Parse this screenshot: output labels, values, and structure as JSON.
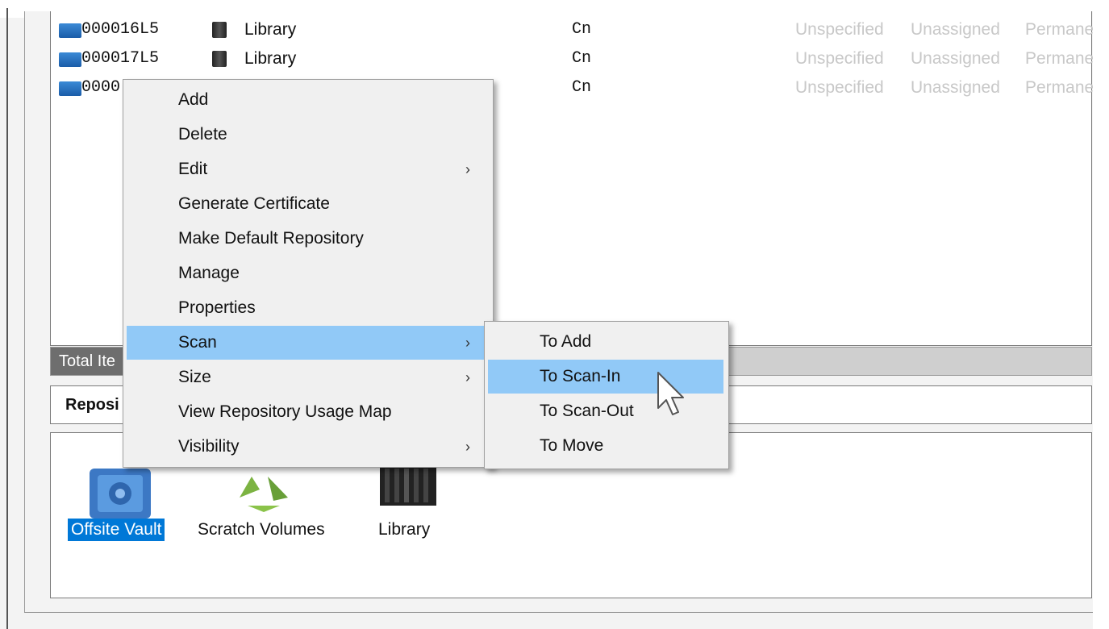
{
  "volumes": [
    {
      "id": "000016L5",
      "repository": "Library",
      "cn": "Cn",
      "col1": "Unspecified",
      "col2": "Unassigned",
      "col3": "Permane"
    },
    {
      "id": "000017L5",
      "repository": "Library",
      "cn": "Cn",
      "col1": "Unspecified",
      "col2": "Unassigned",
      "col3": "Permane"
    },
    {
      "id": "0000",
      "repository": "",
      "cn": "Cn",
      "col1": "Unspecified",
      "col2": "Unassigned",
      "col3": "Permane"
    }
  ],
  "status": {
    "label": "Total Ite"
  },
  "repositories_header": {
    "title": "Reposi"
  },
  "repository_icons": [
    {
      "label": "Offsite Vault",
      "icon": "vault-icon",
      "selected": true
    },
    {
      "label": "Scratch Volumes",
      "icon": "recycle-icon",
      "selected": false
    },
    {
      "label": "Library",
      "icon": "library-icon",
      "selected": false
    }
  ],
  "context_menu": {
    "items": [
      {
        "label": "Add",
        "submenu": false
      },
      {
        "label": "Delete",
        "submenu": false
      },
      {
        "label": "Edit",
        "submenu": true
      },
      {
        "label": "Generate Certificate",
        "submenu": false
      },
      {
        "label": "Make Default Repository",
        "submenu": false
      },
      {
        "label": "Manage",
        "submenu": false
      },
      {
        "label": "Properties",
        "submenu": false
      },
      {
        "label": "Scan",
        "submenu": true,
        "highlighted": true
      },
      {
        "label": "Size",
        "submenu": true
      },
      {
        "label": "View Repository Usage Map",
        "submenu": false
      },
      {
        "label": "Visibility",
        "submenu": true
      }
    ],
    "submenu_arrow": "›"
  },
  "scan_submenu": {
    "items": [
      {
        "label": "To Add"
      },
      {
        "label": "To Scan-In",
        "highlighted": true
      },
      {
        "label": "To Scan-Out"
      },
      {
        "label": "To Move"
      }
    ]
  },
  "colors": {
    "highlight": "#91c9f7",
    "selection": "#0078d7"
  }
}
